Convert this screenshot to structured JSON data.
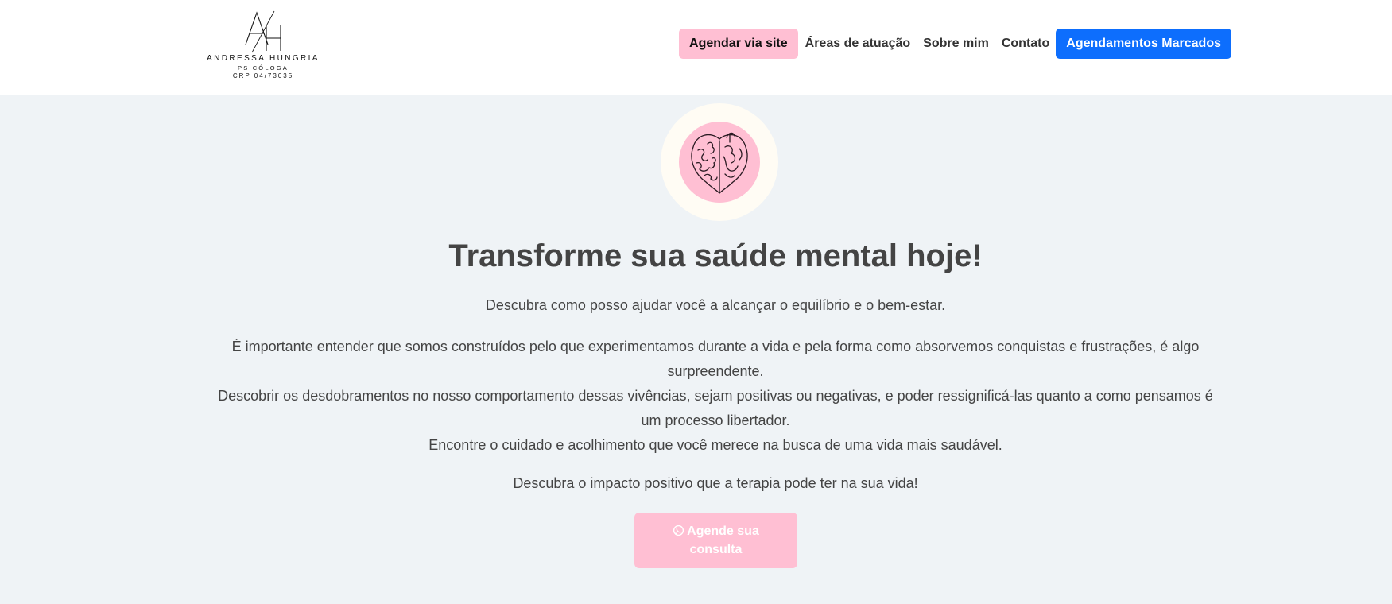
{
  "nav": {
    "logo": {
      "monogram": "AH",
      "name": "ANDRESSA HUNGRIA",
      "role": "PSICÓLOGA",
      "crp": "CRP 04/73035"
    },
    "schedule_site_label": "Agendar via site",
    "links": [
      "Áreas de atuação",
      "Sobre mim",
      "Contato"
    ],
    "appointments_label": "Agendamentos Marcados"
  },
  "hero": {
    "image_icon": "brain-heart-illustration",
    "headline": "Transforme sua saúde mental hoje!",
    "subheadline": "Descubra como posso ajudar você a alcançar o equilíbrio e o bem-estar.",
    "paragraphs": [
      "É importante entender que somos construídos pelo que experimentamos durante a vida e pela forma como absorvemos conquistas e frustrações, é algo surpreendente.",
      "Descobrir os desdobramentos no nosso comportamento dessas vivências, sejam positivas ou negativas, e poder ressignificá-las quanto a como pensamos é um processo libertador.",
      "Encontre o cuidado e acolhimento que você merece na busca de uma vida mais saudável."
    ],
    "impact": "Descubra o impacto positivo que a terapia pode ter na sua vida!",
    "cta_label": "Agende sua consulta",
    "cta_icon": "whatsapp-icon"
  },
  "colors": {
    "pink": "#ffbfd3",
    "blue": "#0d6efd",
    "background": "#eff3f6",
    "text": "#444444"
  }
}
